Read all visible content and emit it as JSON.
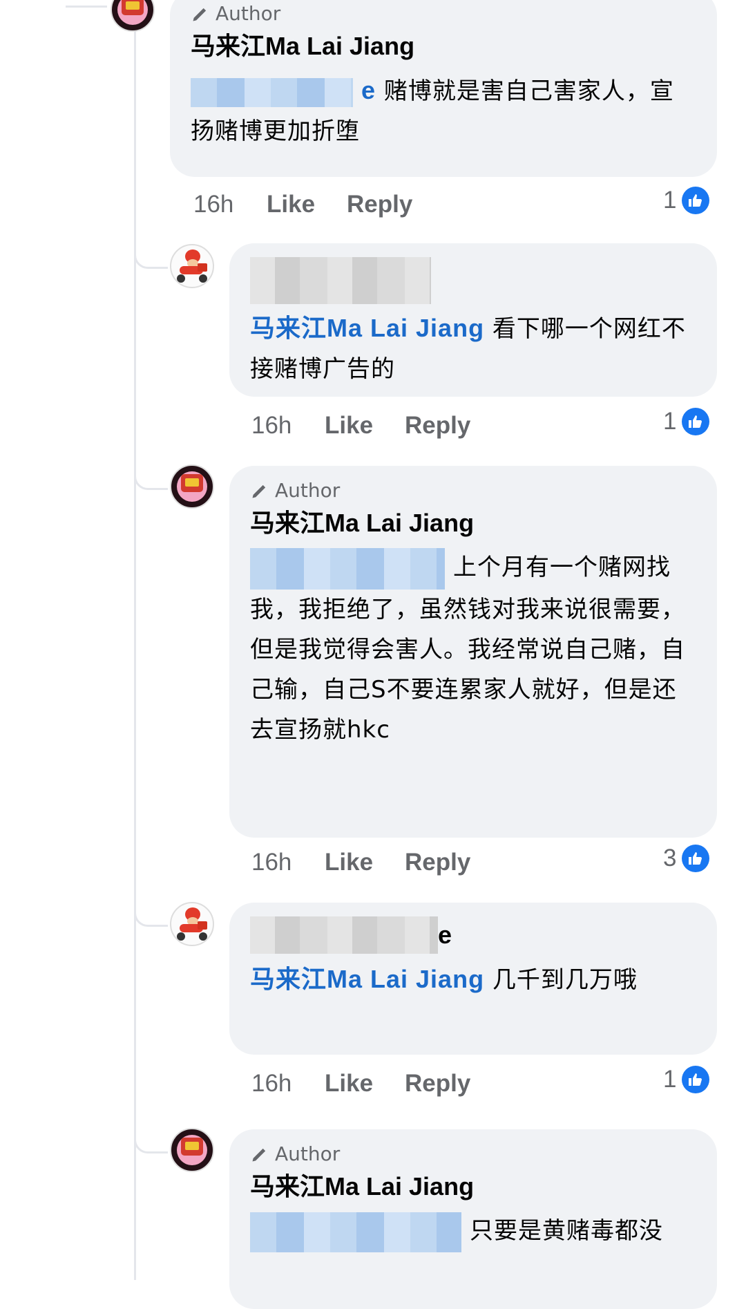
{
  "comments": [
    {
      "author_badge": "Author",
      "name": "马来江Ma Lai Jiang",
      "text": "赌博就是害自己害家人，宣扬赌博更加折堕",
      "meta": {
        "time": "16h",
        "like": "Like",
        "reply": "Reply",
        "reactions": "1"
      }
    },
    {
      "mention": "马来江Ma Lai Jiang",
      "text": "看下哪一个网红不接赌博广告的",
      "meta": {
        "time": "16h",
        "like": "Like",
        "reply": "Reply",
        "reactions": "1"
      }
    },
    {
      "author_badge": "Author",
      "name": "马来江Ma Lai Jiang",
      "text": "上个月有一个赌网找我，我拒绝了，虽然钱对我来说很需要，但是我觉得会害人。我经常说自己赌，自己输，自己S不要连累家人就好，但是还去宣扬就hkc",
      "meta": {
        "time": "16h",
        "like": "Like",
        "reply": "Reply",
        "reactions": "3"
      }
    },
    {
      "name_tail": "e",
      "mention": "马来江Ma Lai Jiang",
      "text": "几千到几万哦",
      "meta": {
        "time": "16h",
        "like": "Like",
        "reply": "Reply",
        "reactions": "1"
      }
    },
    {
      "author_badge": "Author",
      "name": "马来江Ma Lai Jiang",
      "text": "只要是黄赌毒都没"
    }
  ],
  "first_mention_tail": "e",
  "icons": {
    "pen": "pen-icon",
    "like": "like-thumb-icon"
  },
  "colors": {
    "mention": "#1b6ac9",
    "like": "#1877f2",
    "bubble": "#f0f2f5",
    "meta": "#65676b"
  }
}
